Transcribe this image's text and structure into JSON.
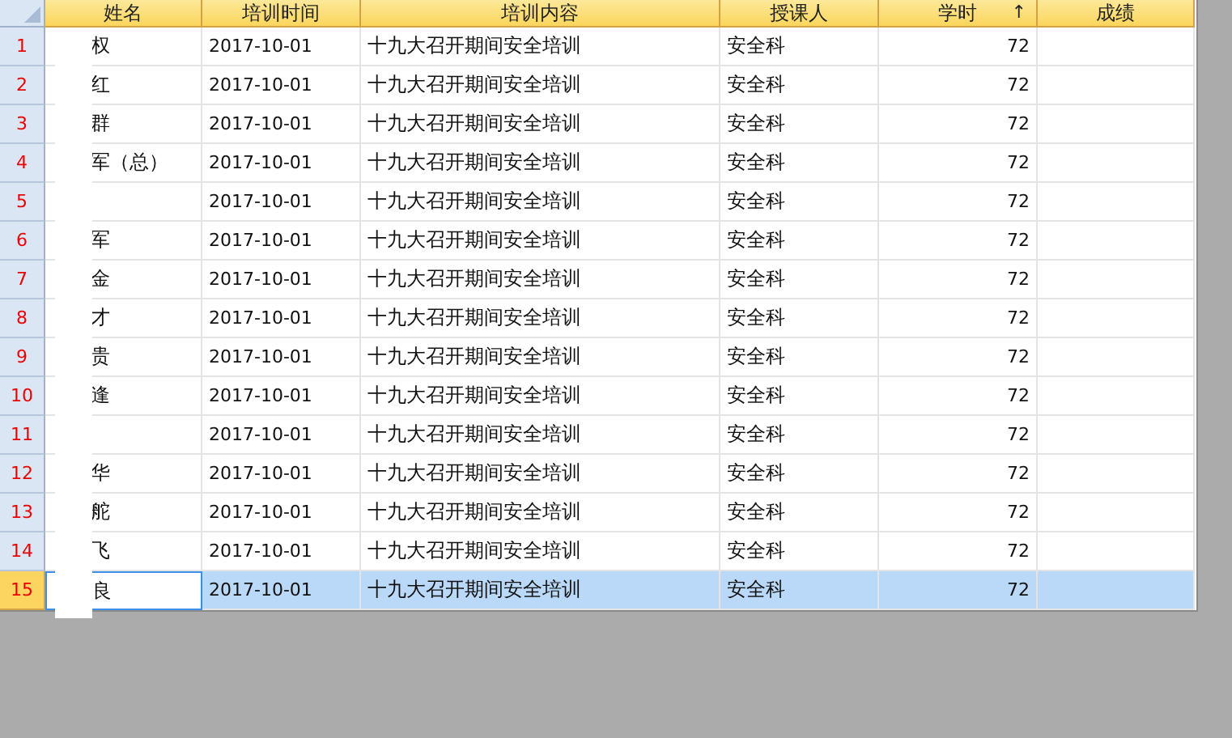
{
  "table": {
    "columns": [
      {
        "label": "姓名"
      },
      {
        "label": "培训时间"
      },
      {
        "label": "培训内容"
      },
      {
        "label": "授课人"
      },
      {
        "label": "学时",
        "sort_indicator": "↑"
      },
      {
        "label": "成绩"
      }
    ],
    "rows": [
      {
        "number": "1",
        "name": "权",
        "date": "2017-10-01",
        "content": "十九大召开期间安全培训",
        "teacher": "安全科",
        "hours": "72",
        "selected": false
      },
      {
        "number": "2",
        "name": "红",
        "date": "2017-10-01",
        "content": "十九大召开期间安全培训",
        "teacher": "安全科",
        "hours": "72",
        "selected": false
      },
      {
        "number": "3",
        "name": "群",
        "date": "2017-10-01",
        "content": "十九大召开期间安全培训",
        "teacher": "安全科",
        "hours": "72",
        "selected": false
      },
      {
        "number": "4",
        "name": "军（总）",
        "date": "2017-10-01",
        "content": "十九大召开期间安全培训",
        "teacher": "安全科",
        "hours": "72",
        "selected": false
      },
      {
        "number": "5",
        "date": "2017-10-01",
        "content": "十九大召开期间安全培训",
        "teacher": "安全科",
        "hours": "72",
        "selected": false
      },
      {
        "number": "6",
        "name": "军",
        "date": "2017-10-01",
        "content": "十九大召开期间安全培训",
        "teacher": "安全科",
        "hours": "72",
        "selected": false
      },
      {
        "number": "7",
        "name": "金",
        "date": "2017-10-01",
        "content": "十九大召开期间安全培训",
        "teacher": "安全科",
        "hours": "72",
        "selected": false
      },
      {
        "number": "8",
        "name": "才",
        "date": "2017-10-01",
        "content": "十九大召开期间安全培训",
        "teacher": "安全科",
        "hours": "72",
        "selected": false
      },
      {
        "number": "9",
        "name": "贵",
        "date": "2017-10-01",
        "content": "十九大召开期间安全培训",
        "teacher": "安全科",
        "hours": "72",
        "selected": false
      },
      {
        "number": "10",
        "name": "逢",
        "date": "2017-10-01",
        "content": "十九大召开期间安全培训",
        "teacher": "安全科",
        "hours": "72",
        "selected": false
      },
      {
        "number": "11",
        "date": "2017-10-01",
        "content": "十九大召开期间安全培训",
        "teacher": "安全科",
        "hours": "72",
        "selected": false
      },
      {
        "number": "12",
        "name": "华",
        "date": "2017-10-01",
        "content": "十九大召开期间安全培训",
        "teacher": "安全科",
        "hours": "72",
        "selected": false
      },
      {
        "number": "13",
        "name": "舵",
        "date": "2017-10-01",
        "content": "十九大召开期间安全培训",
        "teacher": "安全科",
        "hours": "72",
        "selected": false
      },
      {
        "number": "14",
        "name": "飞",
        "date": "2017-10-01",
        "content": "十九大召开期间安全培训",
        "teacher": "安全科",
        "hours": "72",
        "selected": false
      },
      {
        "number": "15",
        "name": "良",
        "date": "2017-10-01",
        "content": "十九大召开期间安全培训",
        "teacher": "安全科",
        "hours": "72",
        "selected": true
      }
    ]
  }
}
